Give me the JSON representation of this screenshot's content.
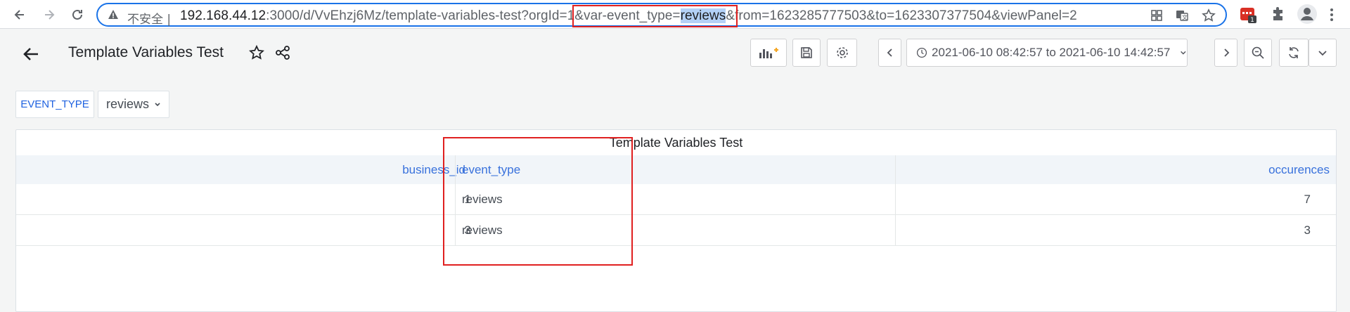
{
  "browser": {
    "insecure_label": "不安全 |",
    "url_host": "192.168.44.12",
    "url_before_sel": ":3000/d/VvEhzj6Mz/template-variables-test?orgId=1&var-event_type=",
    "url_selected": "reviews",
    "url_after_sel": "&from=1623285777503&to=1623307377504&viewPanel=2",
    "extension_badge": "1"
  },
  "dashboard": {
    "title": "Template Variables Test",
    "time_range": "2021-06-10 08:42:57 to 2021-06-10 14:42:57"
  },
  "variable": {
    "label": "EVENT_TYPE",
    "value": "reviews"
  },
  "panel": {
    "title": "Template Variables Test",
    "columns": [
      "business_id",
      "event_type",
      "occurences"
    ],
    "rows": [
      [
        "1",
        "reviews",
        "7"
      ],
      [
        "3",
        "reviews",
        "3"
      ]
    ]
  },
  "colors": {
    "accent": "#1f62e0",
    "annotation": "#e02020",
    "header_text": "#3871dc"
  }
}
